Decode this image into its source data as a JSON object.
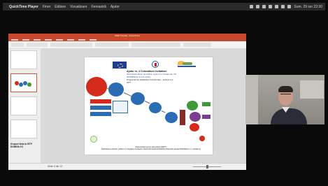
{
  "menubar": {
    "apple": "",
    "app_name": "QuickTime Player",
    "items": [
      "Finer",
      "Editare",
      "Vizualizare",
      "Fereastră",
      "Ajutor"
    ],
    "clock": "Sum. 29 iun 22:30"
  },
  "powerpoint": {
    "window_title": "DWP Tutorial - PowerPoint",
    "thumbnails": {
      "last_thumb_text": "Grupuri tinta la ISTP DOMINA 9.0"
    },
    "status_text": "Slide 3 din 12"
  },
  "slide": {
    "title_line1": "Ajutor nr. 4 Colocatiuni invitatiuni",
    "title_line2": "Ghid Recondirion spectifice: Ajutor 3 si Strateuren Tilt (DOMENIUL 9.0 din 2021",
    "title_line3": "Programul de stabilizare Functionare - sectore 3.1 CPT",
    "footer_line1": "Parteneriatul pentru dezvoltare (DEPT)",
    "footer_line2": "Mobilizarea valorilor publice si culturala a fondurilor CRACIUN GHID ROMANIA Dispozitiv atasat ROMANIA (I nr. invitatiuni)"
  },
  "colors": {
    "menubar": "#2a2a2a",
    "ppt_accent": "#c8482b",
    "red": "#d42b1d",
    "blue": "#2a6db4",
    "green": "#3f9a3a",
    "purple": "#7a3f8f"
  },
  "icons": {
    "menubar_status": [
      "wifi-icon",
      "bluetooth-icon",
      "volume-icon",
      "battery-icon",
      "search-icon",
      "user-icon",
      "control-center-icon"
    ]
  }
}
